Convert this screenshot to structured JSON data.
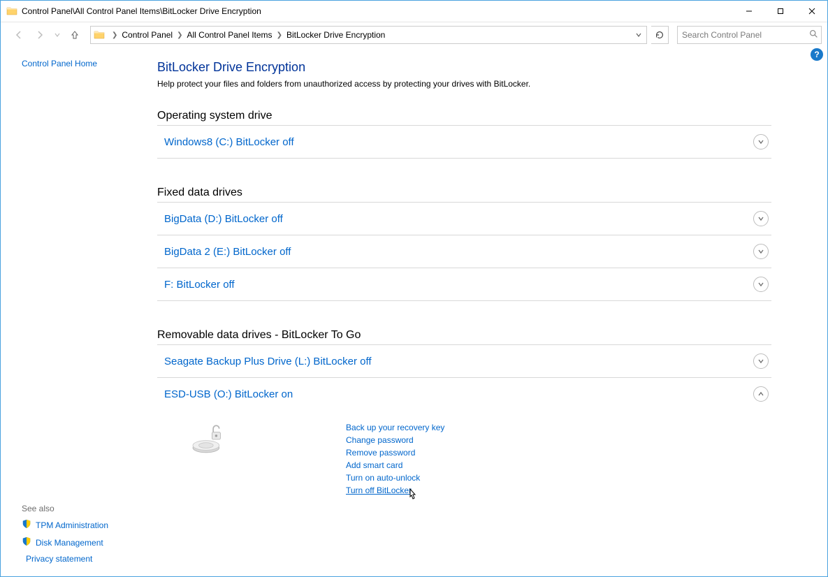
{
  "window": {
    "title": "Control Panel\\All Control Panel Items\\BitLocker Drive Encryption"
  },
  "breadcrumb": {
    "items": [
      "Control Panel",
      "All Control Panel Items",
      "BitLocker Drive Encryption"
    ]
  },
  "search": {
    "placeholder": "Search Control Panel"
  },
  "sidebar": {
    "home": "Control Panel Home",
    "see_also_title": "See also",
    "see_also": [
      "TPM Administration",
      "Disk Management",
      "Privacy statement"
    ]
  },
  "page": {
    "title": "BitLocker Drive Encryption",
    "desc": "Help protect your files and folders from unauthorized access by protecting your drives with BitLocker."
  },
  "sections": {
    "os": {
      "title": "Operating system drive",
      "drives": [
        {
          "label": "Windows8 (C:) BitLocker off",
          "expanded": false
        }
      ]
    },
    "fixed": {
      "title": "Fixed data drives",
      "drives": [
        {
          "label": "BigData (D:) BitLocker off",
          "expanded": false
        },
        {
          "label": "BigData 2 (E:) BitLocker off",
          "expanded": false
        },
        {
          "label": "F: BitLocker off",
          "expanded": false
        }
      ]
    },
    "removable": {
      "title": "Removable data drives - BitLocker To Go",
      "drives": [
        {
          "label": "Seagate Backup Plus Drive (L:) BitLocker off",
          "expanded": false
        },
        {
          "label": "ESD-USB (O:) BitLocker on",
          "expanded": true
        }
      ]
    }
  },
  "actions": [
    "Back up your recovery key",
    "Change password",
    "Remove password",
    "Add smart card",
    "Turn on auto-unlock",
    "Turn off BitLocker"
  ]
}
